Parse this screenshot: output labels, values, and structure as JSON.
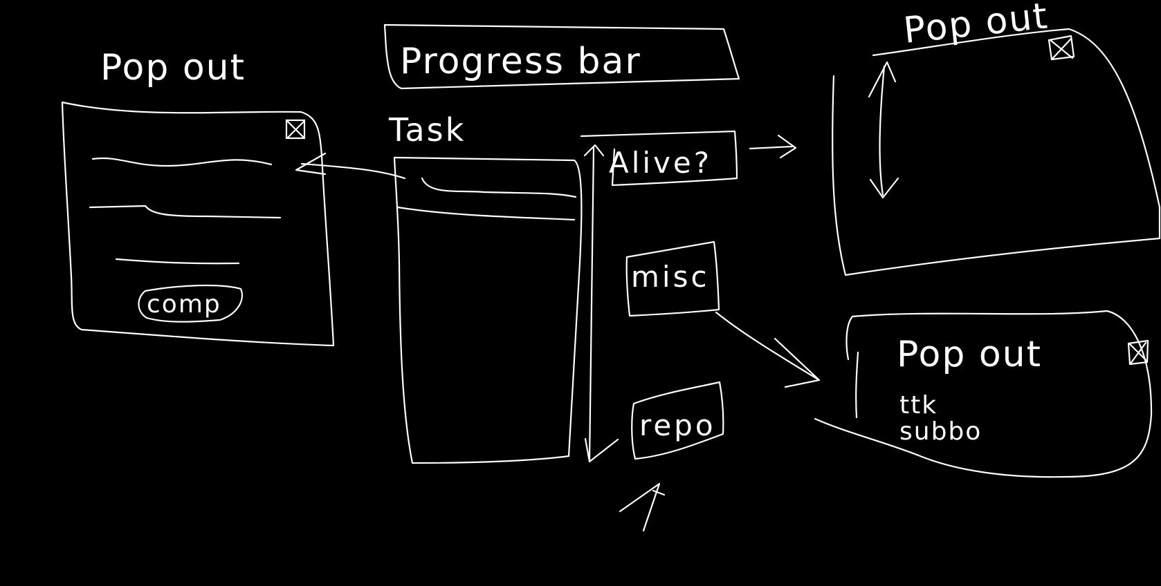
{
  "colors": {
    "background": "#000000",
    "stroke": "#ffffff"
  },
  "left_popout": {
    "title": "Pop out",
    "close_icon": "close-x-icon",
    "button_label": "comp"
  },
  "progress_bar": {
    "label": "Progress bar"
  },
  "task_panel": {
    "label": "Task"
  },
  "buttons": {
    "alive": "Alive?",
    "misc": "misc",
    "repo": "repo"
  },
  "right_popout_top": {
    "title": "Pop out",
    "close_icon": "close-x-icon"
  },
  "right_popout_bottom": {
    "title": "Pop out",
    "close_icon": "close-x-icon",
    "line1": "ttk",
    "line2": "subbo"
  }
}
